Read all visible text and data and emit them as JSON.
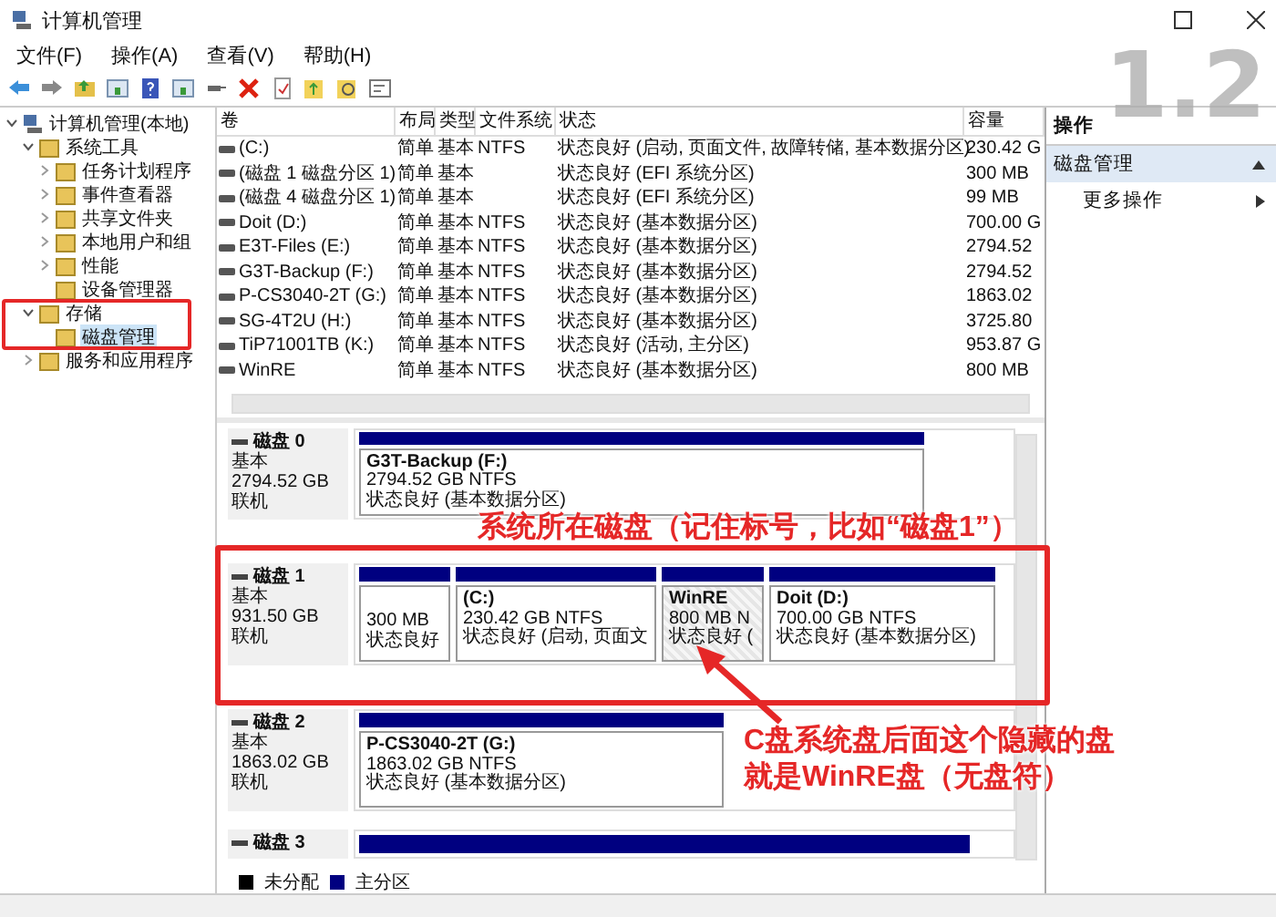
{
  "window": {
    "title": "计算机管理"
  },
  "menu": [
    "文件(F)",
    "操作(A)",
    "查看(V)",
    "帮助(H)"
  ],
  "tree": [
    {
      "label": "计算机管理(本地)",
      "expanded": true,
      "selected": false,
      "children": [
        {
          "label": "系统工具",
          "expanded": true,
          "selected": false,
          "children": [
            {
              "label": "任务计划程序",
              "expanded": false,
              "selected": false
            },
            {
              "label": "事件查看器",
              "expanded": false,
              "selected": false
            },
            {
              "label": "共享文件夹",
              "expanded": false,
              "selected": false
            },
            {
              "label": "本地用户和组",
              "expanded": false,
              "selected": false
            },
            {
              "label": "性能",
              "expanded": false,
              "selected": false
            },
            {
              "label": "设备管理器",
              "selected": false
            }
          ]
        },
        {
          "label": "存储",
          "expanded": true,
          "selected": false,
          "children": [
            {
              "label": "磁盘管理",
              "selected": true
            }
          ]
        },
        {
          "label": "服务和应用程序",
          "expanded": false,
          "selected": false
        }
      ]
    }
  ],
  "volume_table": {
    "columns": [
      "卷",
      "布局",
      "类型",
      "文件系统",
      "状态",
      "容量"
    ],
    "rows": [
      [
        "(C:)",
        "简单",
        "基本",
        "NTFS",
        "状态良好 (启动, 页面文件, 故障转储, 基本数据分区)",
        "230.42 G"
      ],
      [
        "(磁盘 1 磁盘分区 1)",
        "简单",
        "基本",
        "",
        "状态良好 (EFI 系统分区)",
        "300 MB"
      ],
      [
        "(磁盘 4 磁盘分区 1)",
        "简单",
        "基本",
        "",
        "状态良好 (EFI 系统分区)",
        "99 MB"
      ],
      [
        "Doit (D:)",
        "简单",
        "基本",
        "NTFS",
        "状态良好 (基本数据分区)",
        "700.00 G"
      ],
      [
        "E3T-Files (E:)",
        "简单",
        "基本",
        "NTFS",
        "状态良好 (基本数据分区)",
        "2794.52"
      ],
      [
        "G3T-Backup (F:)",
        "简单",
        "基本",
        "NTFS",
        "状态良好 (基本数据分区)",
        "2794.52"
      ],
      [
        "P-CS3040-2T (G:)",
        "简单",
        "基本",
        "NTFS",
        "状态良好 (基本数据分区)",
        "1863.02"
      ],
      [
        "SG-4T2U (H:)",
        "简单",
        "基本",
        "NTFS",
        "状态良好 (基本数据分区)",
        "3725.80"
      ],
      [
        "TiP71001TB (K:)",
        "简单",
        "基本",
        "NTFS",
        "状态良好 (活动, 主分区)",
        "953.87 G"
      ],
      [
        "WinRE",
        "简单",
        "基本",
        "NTFS",
        "状态良好 (基本数据分区)",
        "800 MB"
      ]
    ]
  },
  "disks": [
    {
      "name": "磁盘 0",
      "type": "基本",
      "size": "2794.52 GB",
      "status": "联机",
      "partitions": [
        {
          "label": "G3T-Backup  (F:)",
          "detail": "2794.52 GB NTFS",
          "status": "状态良好 (基本数据分区)",
          "selected": false
        }
      ]
    },
    {
      "name": "磁盘 1",
      "type": "基本",
      "size": "931.50 GB",
      "status": "联机",
      "partitions": [
        {
          "detail": "300 MB",
          "status": "状态良好",
          "selected": false
        },
        {
          "label": " (C:)",
          "detail": "230.42 GB NTFS",
          "status": "状态良好 (启动, 页面文",
          "selected": false
        },
        {
          "label": "WinRE",
          "detail": "800 MB N",
          "status": "状态良好 (",
          "selected": true
        },
        {
          "label": "Doit  (D:)",
          "detail": "700.00 GB NTFS",
          "status": "状态良好 (基本数据分区)",
          "selected": false
        }
      ]
    },
    {
      "name": "磁盘 2",
      "type": "基本",
      "size": "1863.02 GB",
      "status": "联机",
      "partitions": [
        {
          "label": "P-CS3040-2T  (G:)",
          "detail": "1863.02 GB NTFS",
          "status": "状态良好 (基本数据分区)",
          "selected": false
        }
      ]
    },
    {
      "name": "磁盘 3"
    }
  ],
  "legend": [
    {
      "label": "未分配",
      "color": "#000000"
    },
    {
      "label": "主分区",
      "color": "#000080"
    }
  ],
  "actions": {
    "title": "操作",
    "section": "磁盘管理",
    "items": [
      "更多操作"
    ]
  },
  "annotations": {
    "step_label": "1.2",
    "callouts": [
      {
        "lines": [
          "系统所在磁盘（记住标号，比如“磁盘1”）"
        ]
      },
      {
        "lines": [
          "C盘系统盘后面这个隐藏的盘",
          "就是WinRE盘（无盘符）"
        ]
      }
    ]
  }
}
